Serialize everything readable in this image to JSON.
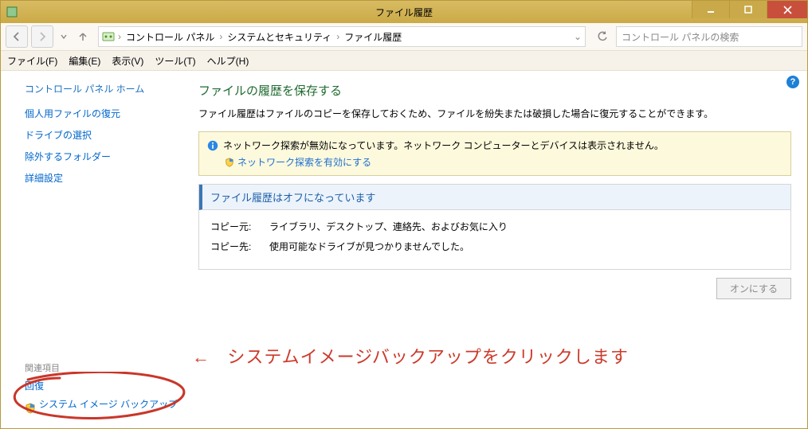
{
  "window": {
    "title": "ファイル履歴"
  },
  "nav": {
    "dropdown_hint": "▾",
    "up_hint": "↑",
    "crumbs": [
      "コントロール パネル",
      "システムとセキュリティ",
      "ファイル履歴"
    ]
  },
  "search": {
    "placeholder": "コントロール パネルの検索"
  },
  "menu": {
    "file": "ファイル(F)",
    "edit": "編集(E)",
    "view": "表示(V)",
    "tools": "ツール(T)",
    "help": "ヘルプ(H)"
  },
  "side": {
    "home": "コントロール パネル ホーム",
    "items": [
      "個人用ファイルの復元",
      "ドライブの選択",
      "除外するフォルダー",
      "詳細設定"
    ],
    "related_head": "関連項目",
    "related_recovery": "回復",
    "related_sysimage": "システム イメージ バックアップ"
  },
  "main": {
    "heading": "ファイルの履歴を保存する",
    "desc": "ファイル履歴はファイルのコピーを保存しておくため、ファイルを紛失または破損した場合に復元することができます。",
    "info_line1": "ネットワーク探索が無効になっています。ネットワーク コンピューターとデバイスは表示されません。",
    "info_link": "ネットワーク探索を有効にする",
    "status_head": "ファイル履歴はオフになっています",
    "copy_from_label": "コピー元:",
    "copy_from_value": "ライブラリ、デスクトップ、連絡先、およびお気に入り",
    "copy_to_label": "コピー先:",
    "copy_to_value": "使用可能なドライブが見つかりませんでした。",
    "turn_on_btn": "オンにする"
  },
  "annotation": {
    "arrow": "←",
    "text": "システムイメージバックアップをクリックします"
  }
}
